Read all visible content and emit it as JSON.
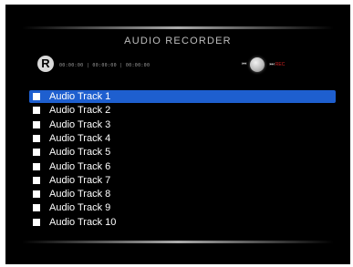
{
  "header": {
    "title": "AUDIO RECORDER",
    "badge": "R",
    "timecode": "00:00:00 | 00:00:00 | 00:00:00"
  },
  "controls": {
    "prev_icon": "skip-back-icon",
    "record_icon": "record-button-icon",
    "next_icon": "skip-forward-icon",
    "prev_glyph": "⏮",
    "next_glyph": "⏭",
    "rec_label": "REC",
    "rec_color": "#cc2222"
  },
  "tracks": [
    {
      "label": "Audio Track 1",
      "selected": true
    },
    {
      "label": "Audio Track 2",
      "selected": false
    },
    {
      "label": "Audio Track 3",
      "selected": false
    },
    {
      "label": "Audio Track 4",
      "selected": false
    },
    {
      "label": "Audio Track 5",
      "selected": false
    },
    {
      "label": "Audio Track 6",
      "selected": false
    },
    {
      "label": "Audio Track 7",
      "selected": false
    },
    {
      "label": "Audio Track 8",
      "selected": false
    },
    {
      "label": "Audio Track 9",
      "selected": false
    },
    {
      "label": "Audio Track 10",
      "selected": false
    }
  ],
  "colors": {
    "background": "#000000",
    "selection": "#1e5fcf",
    "text": "#ffffff"
  }
}
